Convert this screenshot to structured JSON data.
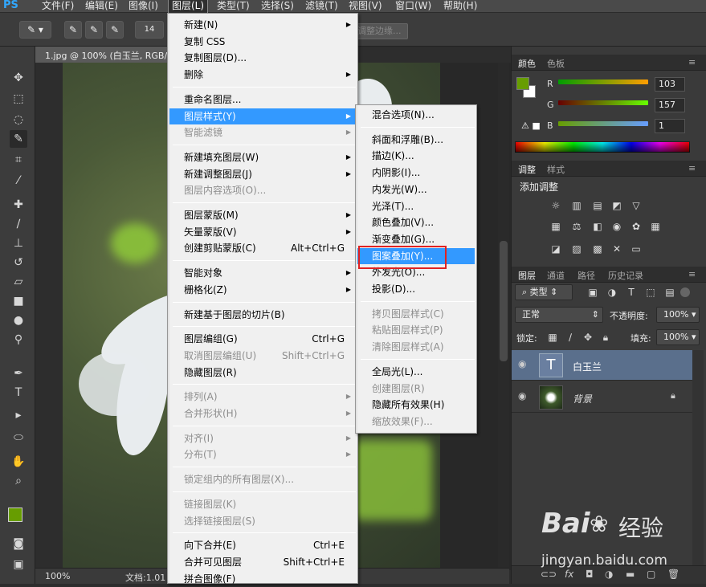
{
  "menubar": {
    "logo": "PS",
    "items": [
      "文件(F)",
      "编辑(E)",
      "图像(I)",
      "图层(L)",
      "类型(T)",
      "选择(S)",
      "滤镜(T)",
      "视图(V)",
      "窗口(W)",
      "帮助(H)"
    ]
  },
  "options": {
    "brush_size": "14",
    "refine_edge": "调整边缘..."
  },
  "document": {
    "tab_title": "1.jpg @ 100% (白玉兰, RGB/...",
    "zoom": "100%",
    "doc_info": "文档:1.01"
  },
  "layer_menu": [
    {
      "label": "新建(N)",
      "arrow": true
    },
    {
      "label": "复制 CSS"
    },
    {
      "label": "复制图层(D)..."
    },
    {
      "label": "删除",
      "arrow": true
    },
    {
      "sep": true
    },
    {
      "label": "重命名图层..."
    },
    {
      "label": "图层样式(Y)",
      "arrow": true,
      "highlight": true
    },
    {
      "label": "智能滤镜",
      "arrow": true,
      "disabled": true
    },
    {
      "sep": true
    },
    {
      "label": "新建填充图层(W)",
      "arrow": true
    },
    {
      "label": "新建调整图层(J)",
      "arrow": true
    },
    {
      "label": "图层内容选项(O)...",
      "disabled": true
    },
    {
      "sep": true
    },
    {
      "label": "图层蒙版(M)",
      "arrow": true
    },
    {
      "label": "矢量蒙版(V)",
      "arrow": true
    },
    {
      "label": "创建剪贴蒙版(C)",
      "shortcut": "Alt+Ctrl+G"
    },
    {
      "sep": true
    },
    {
      "label": "智能对象",
      "arrow": true
    },
    {
      "label": "栅格化(Z)",
      "arrow": true
    },
    {
      "sep": true
    },
    {
      "label": "新建基于图层的切片(B)"
    },
    {
      "sep": true
    },
    {
      "label": "图层编组(G)",
      "shortcut": "Ctrl+G"
    },
    {
      "label": "取消图层编组(U)",
      "shortcut": "Shift+Ctrl+G",
      "disabled": true
    },
    {
      "label": "隐藏图层(R)"
    },
    {
      "sep": true
    },
    {
      "label": "排列(A)",
      "arrow": true,
      "disabled": true
    },
    {
      "label": "合并形状(H)",
      "arrow": true,
      "disabled": true
    },
    {
      "sep": true
    },
    {
      "label": "对齐(I)",
      "arrow": true,
      "disabled": true
    },
    {
      "label": "分布(T)",
      "arrow": true,
      "disabled": true
    },
    {
      "sep": true
    },
    {
      "label": "锁定组内的所有图层(X)...",
      "disabled": true
    },
    {
      "sep": true
    },
    {
      "label": "链接图层(K)",
      "disabled": true
    },
    {
      "label": "选择链接图层(S)",
      "disabled": true
    },
    {
      "sep": true
    },
    {
      "label": "向下合并(E)",
      "shortcut": "Ctrl+E"
    },
    {
      "label": "合并可见图层",
      "shortcut": "Shift+Ctrl+E"
    },
    {
      "label": "拼合图像(F)"
    }
  ],
  "style_menu": [
    {
      "label": "混合选项(N)..."
    },
    {
      "sep": true
    },
    {
      "label": "斜面和浮雕(B)..."
    },
    {
      "label": "描边(K)..."
    },
    {
      "label": "内阴影(I)..."
    },
    {
      "label": "内发光(W)..."
    },
    {
      "label": "光泽(T)..."
    },
    {
      "label": "颜色叠加(V)..."
    },
    {
      "label": "渐变叠加(G)..."
    },
    {
      "label": "图案叠加(Y)...",
      "highlight": true
    },
    {
      "label": "外发光(O)..."
    },
    {
      "label": "投影(D)..."
    },
    {
      "sep": true
    },
    {
      "label": "拷贝图层样式(C)",
      "disabled": true
    },
    {
      "label": "粘贴图层样式(P)",
      "disabled": true
    },
    {
      "label": "清除图层样式(A)",
      "disabled": true
    },
    {
      "sep": true
    },
    {
      "label": "全局光(L)..."
    },
    {
      "label": "创建图层(R)",
      "disabled": true
    },
    {
      "label": "隐藏所有效果(H)"
    },
    {
      "label": "缩放效果(F)...",
      "disabled": true
    }
  ],
  "color_panel": {
    "tabs": [
      "颜色",
      "色板"
    ],
    "r_label": "R",
    "g_label": "G",
    "b_label": "B",
    "r": "103",
    "g": "157",
    "b": "1",
    "foreground": "#679d01",
    "background": "#ffffff"
  },
  "adjust_panel": {
    "tabs": [
      "调整",
      "样式"
    ],
    "title": "添加调整"
  },
  "layers_panel": {
    "tabs": [
      "图层",
      "通道",
      "路径",
      "历史记录"
    ],
    "filter": "类型",
    "blend": "正常",
    "opacity_label": "不透明度:",
    "opacity": "100%",
    "lock_label": "锁定:",
    "fill_label": "填充:",
    "fill": "100%",
    "layers": [
      {
        "name": "白玉兰",
        "type": "text",
        "selected": true
      },
      {
        "name": "背景",
        "type": "image",
        "locked": true
      }
    ]
  },
  "watermark": {
    "brand": "Bai",
    "brand2": "经验",
    "url": "jingyan.baidu.com"
  },
  "colors": {
    "accent": "#3399ff",
    "highlight_box": "#e02222",
    "layer_selected": "#5a6f8c"
  }
}
